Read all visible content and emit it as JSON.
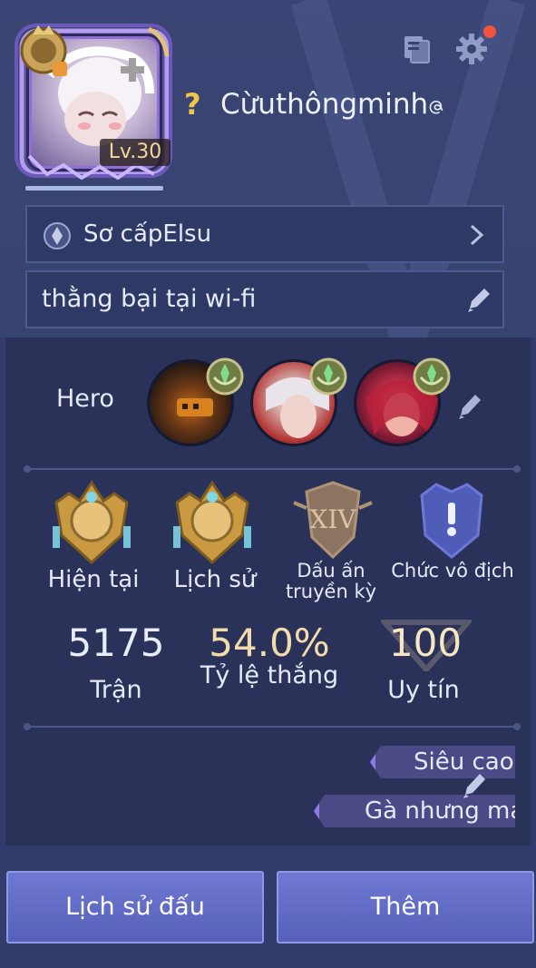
{
  "profile": {
    "level": "Lv.30",
    "username": "Cừuthôngminh",
    "username_suffix_glyph": "ဇ"
  },
  "rank_row": {
    "rank_text": "Sơ cấpElsu"
  },
  "motto_row": {
    "text": "thằng bại tại wi-fi"
  },
  "heroes": {
    "label": "Hero",
    "items": [
      {
        "name": "hero-1"
      },
      {
        "name": "hero-2"
      },
      {
        "name": "hero-3"
      }
    ]
  },
  "emblems": [
    {
      "label": "Hiện tại"
    },
    {
      "label": "Lịch sử"
    },
    {
      "label": "Dấu ấn truyền kỳ",
      "numeral": "XIV"
    },
    {
      "label": "Chức vô địch"
    }
  ],
  "stats": {
    "matches_value": "5175",
    "matches_label": "Trận",
    "winrate_value": "54.0%",
    "winrate_label": "Tỷ lệ thắng",
    "credit_value": "100",
    "credit_label": "Uy tín"
  },
  "titles": [
    {
      "text": "Siêu cao"
    },
    {
      "text": "Gà nhưng ma"
    }
  ],
  "buttons": {
    "history_label": "Lịch sử đấu",
    "more_label": "Thêm"
  },
  "colors": {
    "background": "#323c6a",
    "card": "#2a3259",
    "button": "#5f6ac4",
    "gold_text": "#f2ddaa",
    "notification": "#f2543d",
    "question_mark": "#f0c64a"
  }
}
